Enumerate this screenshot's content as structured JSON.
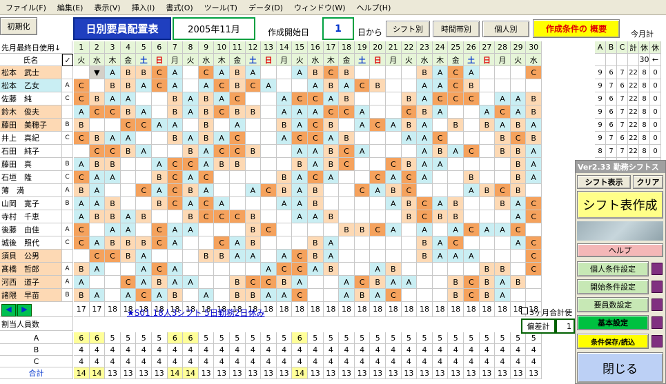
{
  "menu": [
    "ファイル(F)",
    "編集(E)",
    "表示(V)",
    "挿入(I)",
    "書式(O)",
    "ツール(T)",
    "データ(D)",
    "ウィンドウ(W)",
    "ヘルプ(H)"
  ],
  "top": {
    "init_button": "初期化",
    "title": "日別要員配置表",
    "month": "2005年11月",
    "start_label": "作成開始日",
    "start_day": "1",
    "from_label": "日から",
    "btn_shift": "シフト別",
    "btn_time": "時間帯別",
    "btn_person": "個人別",
    "btn_overview": "作成条件の 概要",
    "month_total": "今月計"
  },
  "header": {
    "last_day_label": "先月最終日使用↓",
    "name_label": "氏名",
    "checkbox": "✓"
  },
  "days": [
    1,
    2,
    3,
    4,
    5,
    6,
    7,
    8,
    9,
    10,
    11,
    12,
    13,
    14,
    15,
    16,
    17,
    18,
    19,
    20,
    21,
    22,
    23,
    24,
    25,
    26,
    27,
    28,
    29,
    30
  ],
  "weekdays": [
    "火",
    "水",
    "木",
    "金",
    "土",
    "日",
    "月",
    "火",
    "水",
    "木",
    "金",
    "土",
    "日",
    "月",
    "火",
    "水",
    "木",
    "金",
    "土",
    "日",
    "月",
    "火",
    "水",
    "木",
    "金",
    "土",
    "日",
    "月",
    "火",
    "水"
  ],
  "summary_headers": [
    "A",
    "B",
    "C",
    "計",
    "休",
    "休"
  ],
  "summary_sub": [
    "",
    "",
    "",
    "",
    "30",
    "←"
  ],
  "staff": [
    {
      "name": "松本　武士",
      "type": "",
      "shifts": [
        "",
        "▼",
        "A",
        "B",
        "B",
        "C",
        "A",
        "",
        "C",
        "A",
        "B",
        "A",
        "",
        "",
        "A",
        "B",
        "C",
        "B",
        "",
        "",
        "",
        "",
        "B",
        "A",
        "C",
        "A",
        "",
        "",
        "",
        "C"
      ],
      "sum": [
        "9",
        "6",
        "7",
        "22",
        "8",
        "0"
      ]
    },
    {
      "name": "松本　乙女",
      "type": "A",
      "shifts": [
        "C",
        "",
        "B",
        "B",
        "A",
        "C",
        "A",
        "",
        "A",
        "C",
        "B",
        "C",
        "A",
        "",
        "",
        "A",
        "B",
        "A",
        "C",
        "B",
        "",
        "",
        "A",
        "A",
        "C",
        "B",
        "",
        "",
        "",
        ""
      ],
      "sum": [
        "9",
        "7",
        "6",
        "22",
        "8",
        "0"
      ]
    },
    {
      "name": "佐藤　純",
      "type": "C",
      "shifts": [
        "C",
        "B",
        "A",
        "A",
        "",
        "",
        "B",
        "A",
        "B",
        "A",
        "C",
        "",
        "",
        "A",
        "C",
        "C",
        "A",
        "B",
        "",
        "",
        "",
        "B",
        "A",
        "C",
        "C",
        "C",
        "",
        "A",
        "A",
        "B"
      ],
      "sum": [
        "9",
        "6",
        "7",
        "22",
        "8",
        "0"
      ]
    },
    {
      "name": "鈴木　俊夫",
      "type": "",
      "shifts": [
        "A",
        "C",
        "C",
        "B",
        "A",
        "",
        "B",
        "A",
        "B",
        "C",
        "B",
        "B",
        "",
        "A",
        "A",
        "A",
        "C",
        "C",
        "A",
        "",
        "",
        "C",
        "B",
        "A",
        "",
        "",
        "A",
        "C",
        "A",
        "B"
      ],
      "sum": [
        "9",
        "6",
        "7",
        "22",
        "8",
        "0"
      ]
    },
    {
      "name": "藤田　美穂子",
      "type": "B",
      "shifts": [
        "B",
        "",
        "",
        "C",
        "C",
        "A",
        "A",
        "",
        "B",
        "",
        "A",
        "",
        "",
        "B",
        "A",
        "C",
        "B",
        "",
        "A",
        "C",
        "A",
        "B",
        "A",
        "",
        "B",
        "",
        "B",
        "A",
        "B",
        "A"
      ],
      "sum": [
        "9",
        "6",
        "7",
        "22",
        "8",
        "0"
      ]
    },
    {
      "name": "井上　真紀",
      "type": "C",
      "shifts": [
        "C",
        "B",
        "A",
        "A",
        "",
        "",
        "B",
        "A",
        "B",
        "A",
        "C",
        "",
        "",
        "A",
        "C",
        "C",
        "A",
        "B",
        "",
        "",
        "",
        "A",
        "A",
        "C",
        "",
        "",
        "",
        "B",
        "C",
        "B"
      ],
      "sum": [
        "9",
        "7",
        "6",
        "22",
        "8",
        "0"
      ]
    },
    {
      "name": "石田　純子",
      "type": "",
      "shifts": [
        "",
        "C",
        "C",
        "B",
        "A",
        "",
        "",
        "B",
        "A",
        "C",
        "C",
        "B",
        "",
        "",
        "A",
        "A",
        "B",
        "C",
        "A",
        "",
        "",
        "",
        "A",
        "B",
        "A",
        "C",
        "",
        "B",
        "B",
        "A"
      ],
      "sum": [
        "8",
        "7",
        "7",
        "22",
        "8",
        "0"
      ]
    },
    {
      "name": "藤田　真",
      "type": "B",
      "shifts": [
        "A",
        "B",
        "B",
        "",
        "",
        "A",
        "C",
        "C",
        "A",
        "B",
        "B",
        "",
        "",
        "",
        "B",
        "A",
        "B",
        "C",
        "",
        "",
        "C",
        "B",
        "A",
        "A",
        "",
        "",
        "",
        "",
        "B",
        "A"
      ],
      "sum": [
        "",
        "",
        "",
        "",
        "",
        ""
      ]
    },
    {
      "name": "石垣　隆",
      "type": "C",
      "shifts": [
        "C",
        "A",
        "A",
        "",
        "",
        "B",
        "C",
        "A",
        "C",
        "",
        "",
        "",
        "",
        "B",
        "A",
        "C",
        "A",
        "",
        "",
        "C",
        "A",
        "C",
        "A",
        "",
        "",
        "B",
        "",
        "",
        "B",
        "A"
      ],
      "sum": [
        "",
        "",
        "",
        "",
        "",
        ""
      ]
    },
    {
      "name": "薄　満",
      "type": "A",
      "shifts": [
        "B",
        "A",
        "",
        "",
        "C",
        "A",
        "C",
        "B",
        "A",
        "",
        "",
        "A",
        "C",
        "B",
        "A",
        "B",
        "",
        "",
        "C",
        "A",
        "B",
        "C",
        "",
        "",
        "",
        "A",
        "B",
        "C",
        "B",
        ""
      ],
      "sum": [
        "",
        "",
        "",
        "",
        "",
        ""
      ]
    },
    {
      "name": "山岡　寛子",
      "type": "B",
      "shifts": [
        "A",
        "A",
        "B",
        "",
        "",
        "B",
        "C",
        "A",
        "C",
        "A",
        "",
        "",
        "",
        "A",
        "A",
        "B",
        "",
        "",
        "",
        "",
        "A",
        "B",
        "C",
        "A",
        "B",
        "",
        "",
        "B",
        "A",
        "C"
      ],
      "sum": [
        "",
        "",
        "",
        "",
        "",
        ""
      ]
    },
    {
      "name": "寺村　千恵",
      "type": "",
      "shifts": [
        "A",
        "B",
        "B",
        "A",
        "B",
        "",
        "",
        "B",
        "C",
        "C",
        "C",
        "B",
        "",
        "",
        "A",
        "A",
        "B",
        "",
        "",
        "",
        "",
        "B",
        "C",
        "B",
        "B",
        "",
        "",
        "",
        "A",
        "C"
      ],
      "sum": [
        "",
        "",
        "",
        "",
        "",
        ""
      ]
    },
    {
      "name": "後藤　由佳",
      "type": "A",
      "shifts": [
        "C",
        "",
        "A",
        "A",
        "",
        "C",
        "A",
        "A",
        "",
        "",
        "",
        "B",
        "C",
        "",
        "",
        "",
        "",
        "B",
        "B",
        "C",
        "A",
        "",
        "A",
        "",
        "A",
        "C",
        "A",
        "A",
        "C",
        ""
      ],
      "sum": [
        "",
        "",
        "",
        "",
        "",
        ""
      ]
    },
    {
      "name": "城後　照代",
      "type": "C",
      "shifts": [
        "C",
        "A",
        "B",
        "B",
        "B",
        "C",
        "A",
        "",
        "",
        "C",
        "A",
        "B",
        "",
        "",
        "",
        "B",
        "A",
        "",
        "",
        "",
        "",
        "",
        "B",
        "A",
        "C",
        "",
        "",
        "",
        "A",
        "C"
      ],
      "sum": [
        "",
        "",
        "",
        "",
        "",
        ""
      ]
    },
    {
      "name": "須貝　公男",
      "type": "",
      "shifts": [
        "",
        "C",
        "C",
        "B",
        "A",
        "",
        "",
        "",
        "B",
        "B",
        "A",
        "A",
        "",
        "A",
        "C",
        "B",
        "A",
        "",
        "",
        "",
        "",
        "",
        "B",
        "A",
        "A",
        "A",
        "",
        "",
        "",
        "C"
      ],
      "sum": [
        "",
        "",
        "",
        "",
        "",
        ""
      ]
    },
    {
      "name": "髙橋　哲郎",
      "type": "A",
      "shifts": [
        "B",
        "A",
        "",
        "",
        "A",
        "C",
        "A",
        "",
        "",
        "",
        "",
        "",
        "A",
        "C",
        "C",
        "A",
        "B",
        "",
        "",
        "A",
        "B",
        "",
        "",
        "",
        "",
        "",
        "B",
        "B",
        "",
        "C"
      ],
      "sum": [
        "",
        "",
        "",
        "",
        "",
        ""
      ]
    },
    {
      "name": "河西　道子",
      "type": "A",
      "shifts": [
        "A",
        "",
        "",
        "C",
        "A",
        "B",
        "A",
        "A",
        "",
        "",
        "B",
        "C",
        "C",
        "B",
        "A",
        "",
        "",
        "A",
        "C",
        "B",
        "A",
        "A",
        "",
        "",
        "B",
        "C",
        "B",
        "A",
        "B",
        ""
      ],
      "sum": [
        "",
        "",
        "",
        "",
        "",
        ""
      ]
    },
    {
      "name": "諸隈　早苗",
      "type": "B",
      "shifts": [
        "B",
        "A",
        "",
        "A",
        "C",
        "A",
        "B",
        "",
        "A",
        "",
        "B",
        "B",
        "A",
        "A",
        "C",
        "",
        "",
        "A",
        "B",
        "A",
        "C",
        "",
        "",
        "",
        "B",
        "C",
        "B",
        "A",
        "",
        ""
      ],
      "sum": [
        "",
        "",
        "",
        "",
        "",
        ""
      ]
    }
  ],
  "daily_counts": [
    17,
    17,
    18,
    18,
    18,
    18,
    18,
    18,
    18,
    18,
    18,
    18,
    18,
    18,
    18,
    18,
    18,
    18,
    18,
    18,
    18,
    18,
    18,
    18,
    18,
    18,
    18,
    18,
    18,
    18
  ],
  "pattern_link": "★S01 18人3シフト 5日勤務2日休み",
  "three_month": "3ヶ月合計使",
  "deviation_label": "偏差計",
  "deviation_value": "1",
  "assign_label": "割当人員数",
  "assign_rows": [
    {
      "label": "A",
      "values": [
        6,
        6,
        5,
        5,
        5,
        5,
        6,
        6,
        5,
        5,
        5,
        5,
        5,
        5,
        6,
        5,
        5,
        5,
        5,
        5,
        5,
        5,
        5,
        5,
        5,
        5,
        5,
        5,
        5,
        5
      ]
    },
    {
      "label": "B",
      "values": [
        4,
        4,
        4,
        4,
        4,
        4,
        4,
        4,
        4,
        4,
        4,
        4,
        4,
        4,
        4,
        4,
        4,
        4,
        4,
        4,
        4,
        4,
        4,
        4,
        4,
        4,
        4,
        4,
        4,
        4
      ]
    },
    {
      "label": "C",
      "values": [
        4,
        4,
        4,
        4,
        4,
        4,
        4,
        4,
        4,
        4,
        4,
        4,
        4,
        4,
        4,
        4,
        4,
        4,
        4,
        4,
        4,
        4,
        4,
        4,
        4,
        4,
        4,
        4,
        4,
        4
      ]
    },
    {
      "label": "合計",
      "values": [
        14,
        14,
        13,
        13,
        13,
        13,
        14,
        14,
        13,
        13,
        13,
        13,
        13,
        13,
        14,
        13,
        13,
        13,
        13,
        13,
        13,
        13,
        13,
        13,
        13,
        13,
        13,
        13,
        13,
        13
      ]
    }
  ],
  "panel": {
    "version": "Ver2.33 勤務シフトス",
    "shift_table": "シフト表示",
    "clear": "クリア",
    "create": "シフト表作成",
    "help": "ヘルプ",
    "personal": "個人条件設定",
    "start": "開始条件設定",
    "staff_count": "要員数設定",
    "basic": "基本設定",
    "save": "条件保存/読込",
    "close": "閉じる"
  },
  "colors": {
    "A": "#ffffff",
    "B": "#ffffff",
    "C": "#ffffff",
    "orange": "#f5a25d",
    "light": "#c9eef3",
    "peach": "#fdd9b4",
    "yellow": "#ffff99",
    "green": "#00b050"
  }
}
